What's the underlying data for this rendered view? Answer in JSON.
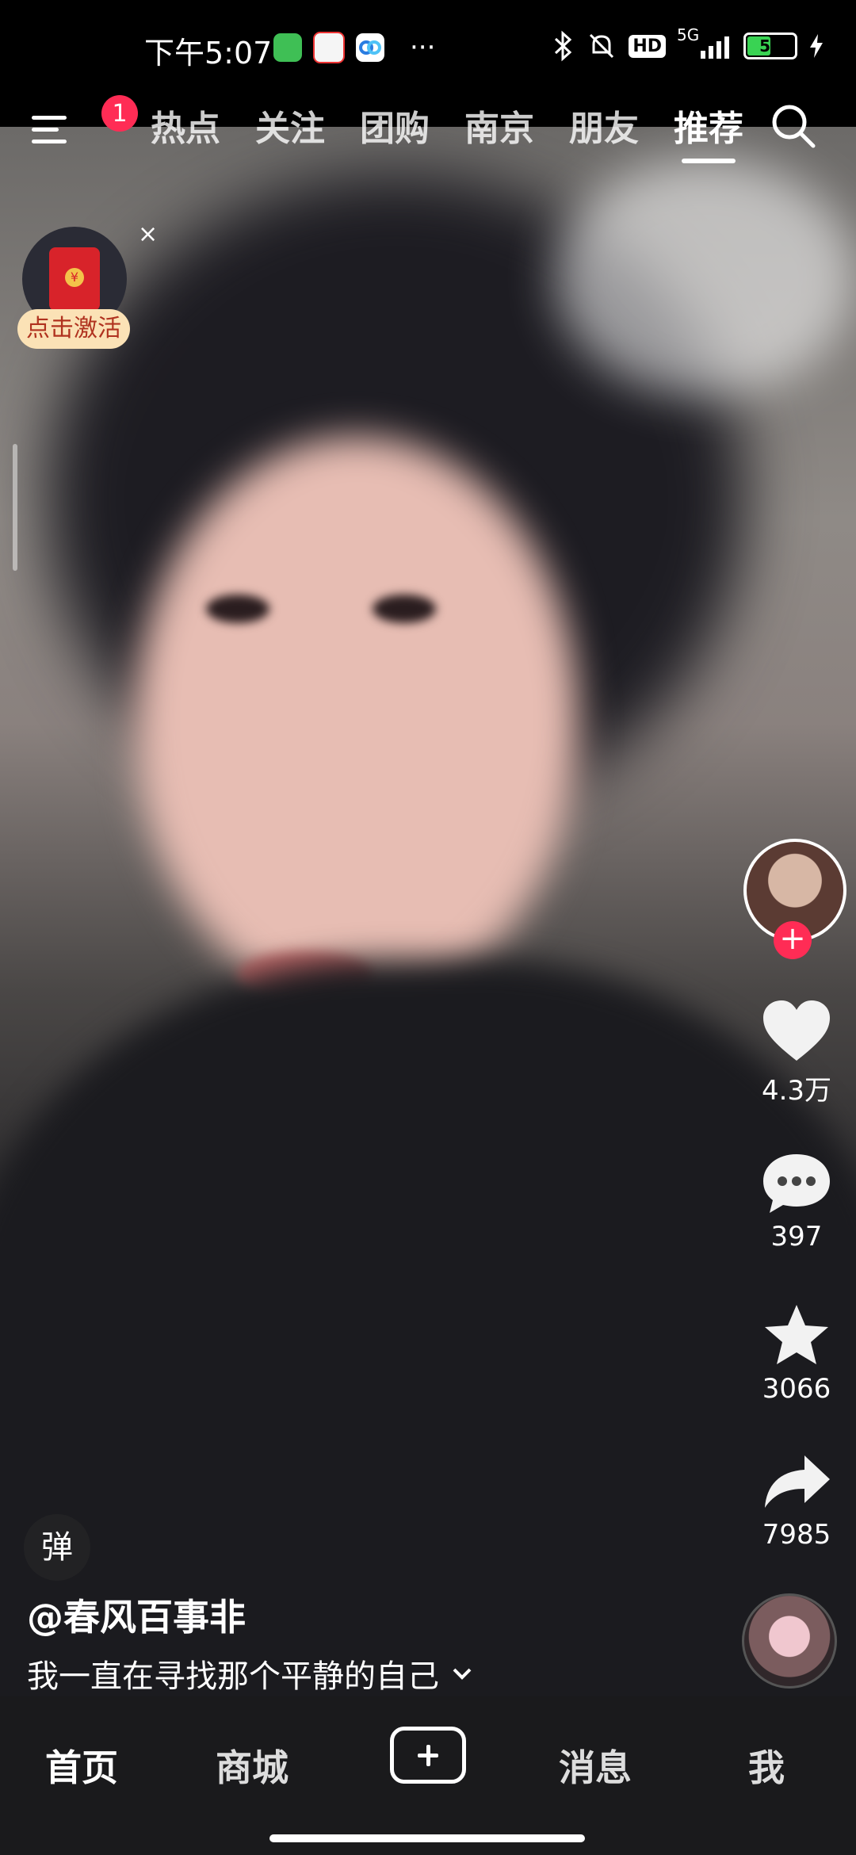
{
  "status_bar": {
    "time": "下午5:07",
    "network": "5G",
    "battery_level": "53",
    "battery_percent": 53,
    "hd_badge": "HD",
    "icons": [
      "wechat-icon",
      "58-app-icon",
      "baidu-netdisk-icon",
      "more-dots-icon",
      "bluetooth-icon",
      "silent-bell-icon",
      "signal-icon",
      "charging-bolt-icon"
    ]
  },
  "top_nav": {
    "notification_count": "1",
    "tabs": [
      {
        "label": "热点"
      },
      {
        "label": "关注"
      },
      {
        "label": "团购"
      },
      {
        "label": "南京"
      },
      {
        "label": "朋友"
      },
      {
        "label": "推荐"
      }
    ],
    "active_tab": "推荐"
  },
  "red_packet": {
    "label": "点击激活",
    "close": "×"
  },
  "actions": {
    "likes": "4.3万",
    "comments": "397",
    "favorites": "3066",
    "shares": "7985"
  },
  "danmaku": {
    "label": "弹"
  },
  "video": {
    "author": "@春风百事非",
    "description": "我一直在寻找那个平静的自己"
  },
  "bottom_nav": {
    "home": "首页",
    "mall": "商城",
    "messages": "消息",
    "me": "我"
  },
  "colors": {
    "accent_red": "#ff2c55",
    "battery_green": "#39d353"
  }
}
